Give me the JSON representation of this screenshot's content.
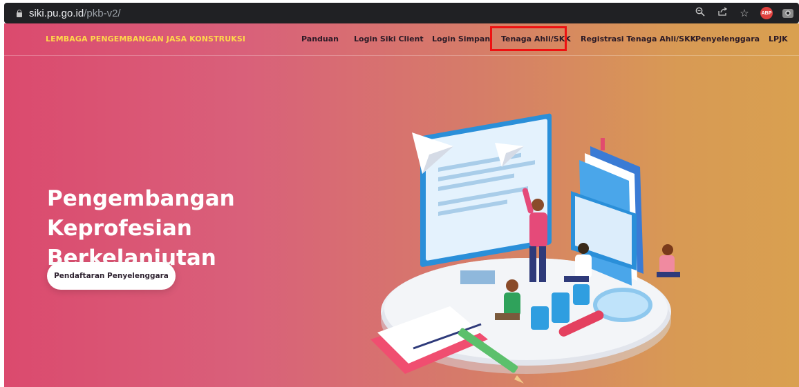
{
  "browser": {
    "url_host": "siki.pu.go.id",
    "url_path": "/pkb-v2/",
    "icons": [
      "zoom-icon",
      "share-icon",
      "bookmark-star-icon",
      "adblock-plus-icon",
      "camera-extension-icon"
    ],
    "abp_label": "ABP"
  },
  "navbar": {
    "brand": "LEMBAGA PENGEMBANGAN JASA KONSTRUKSI",
    "items": [
      {
        "label": "Panduan"
      },
      {
        "label": "Login Siki Client"
      },
      {
        "label": "Login Simpan"
      },
      {
        "label": "Tenaga Ahli/SKK",
        "highlighted": true
      },
      {
        "label": "Registrasi Tenaga Ahli/SKK"
      },
      {
        "label": "Penyelenggara"
      },
      {
        "label": "LPJK"
      }
    ]
  },
  "hero": {
    "title_line1": "Pengembangan Keprofesian",
    "title_line2": "Berkelanjutan",
    "cta_label": "Pendaftaran Penyelenggara"
  },
  "colors": {
    "gradient_start": "#db4a6e",
    "gradient_end": "#d9a050",
    "brand_text": "#ffd84a",
    "highlight_border": "#ee1111"
  }
}
